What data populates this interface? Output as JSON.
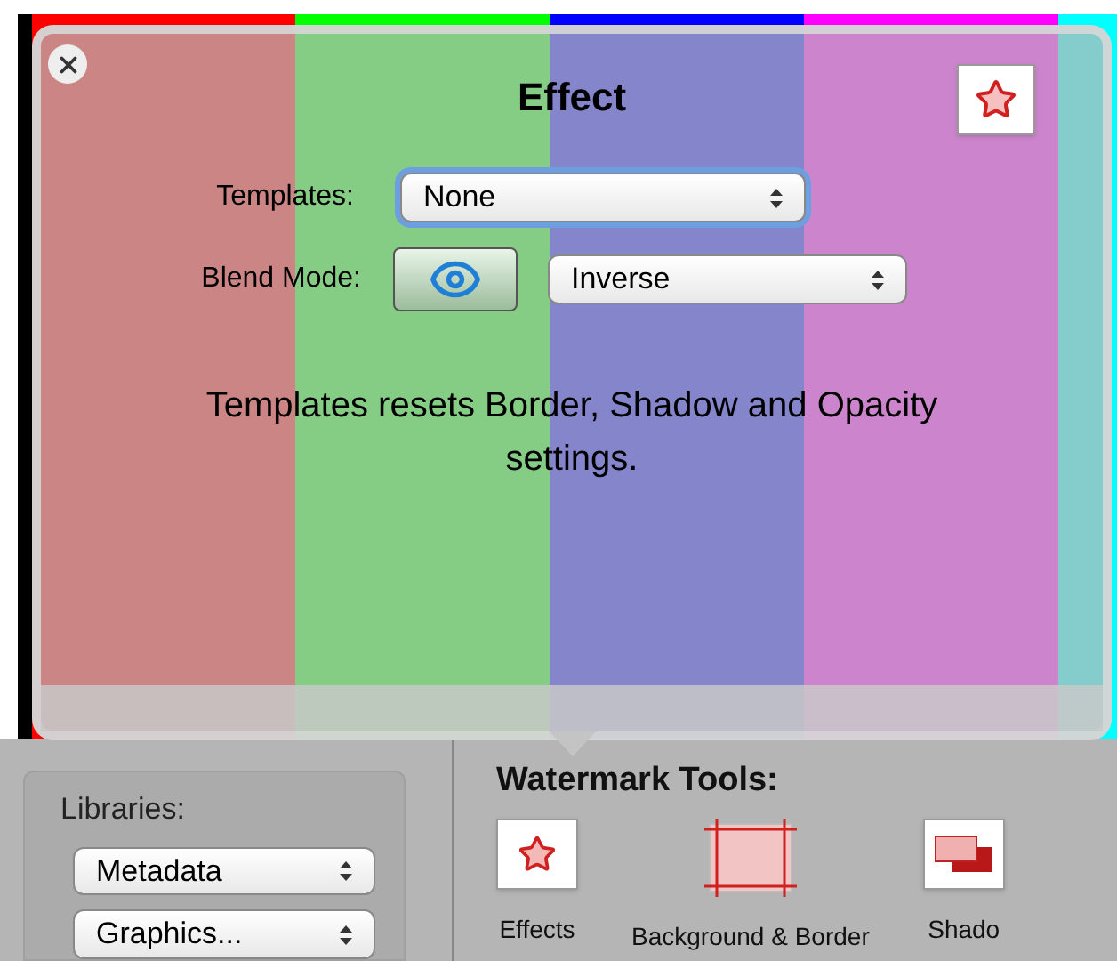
{
  "preview": {
    "bars": [
      {
        "color": "#ff0000"
      },
      {
        "color": "#00ff00"
      },
      {
        "color": "#0000ff"
      },
      {
        "color": "#ff00ff"
      },
      {
        "color": "#00ffff"
      }
    ]
  },
  "popover": {
    "title": "Effect",
    "templates": {
      "label": "Templates:",
      "value": "None",
      "focused": true
    },
    "blend_mode": {
      "label": "Blend Mode:",
      "value": "Inverse",
      "focused": false
    },
    "note": "Templates resets Border, Shadow and Opacity settings."
  },
  "libraries": {
    "label": "Libraries:",
    "popups": [
      "Metadata",
      "Graphics..."
    ]
  },
  "watermark_tools": {
    "title": "Watermark Tools:",
    "items": [
      {
        "kind": "effects",
        "label": "Effects"
      },
      {
        "kind": "border",
        "label": "Background & Border"
      },
      {
        "kind": "shadow",
        "label": "Shado"
      }
    ]
  }
}
